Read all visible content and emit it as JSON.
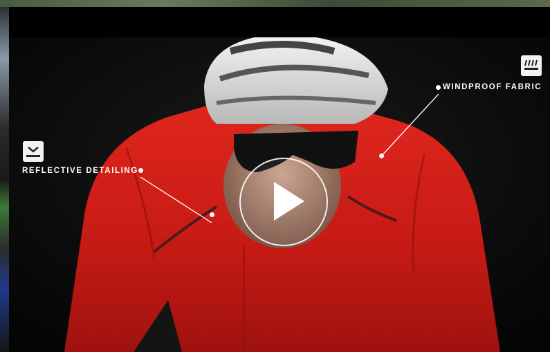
{
  "video": {
    "play_label": "Play video",
    "callouts": {
      "windproof": {
        "label": "WINDPROOF FABRIC",
        "icon": "wind-lines-icon"
      },
      "reflective": {
        "label": "REFLECTIVE DETAILING",
        "icon": "reflective-chevron-icon"
      }
    }
  },
  "colors": {
    "jacket": "#c41a14",
    "background": "#0a0a0a",
    "callout": "#ffffff"
  }
}
